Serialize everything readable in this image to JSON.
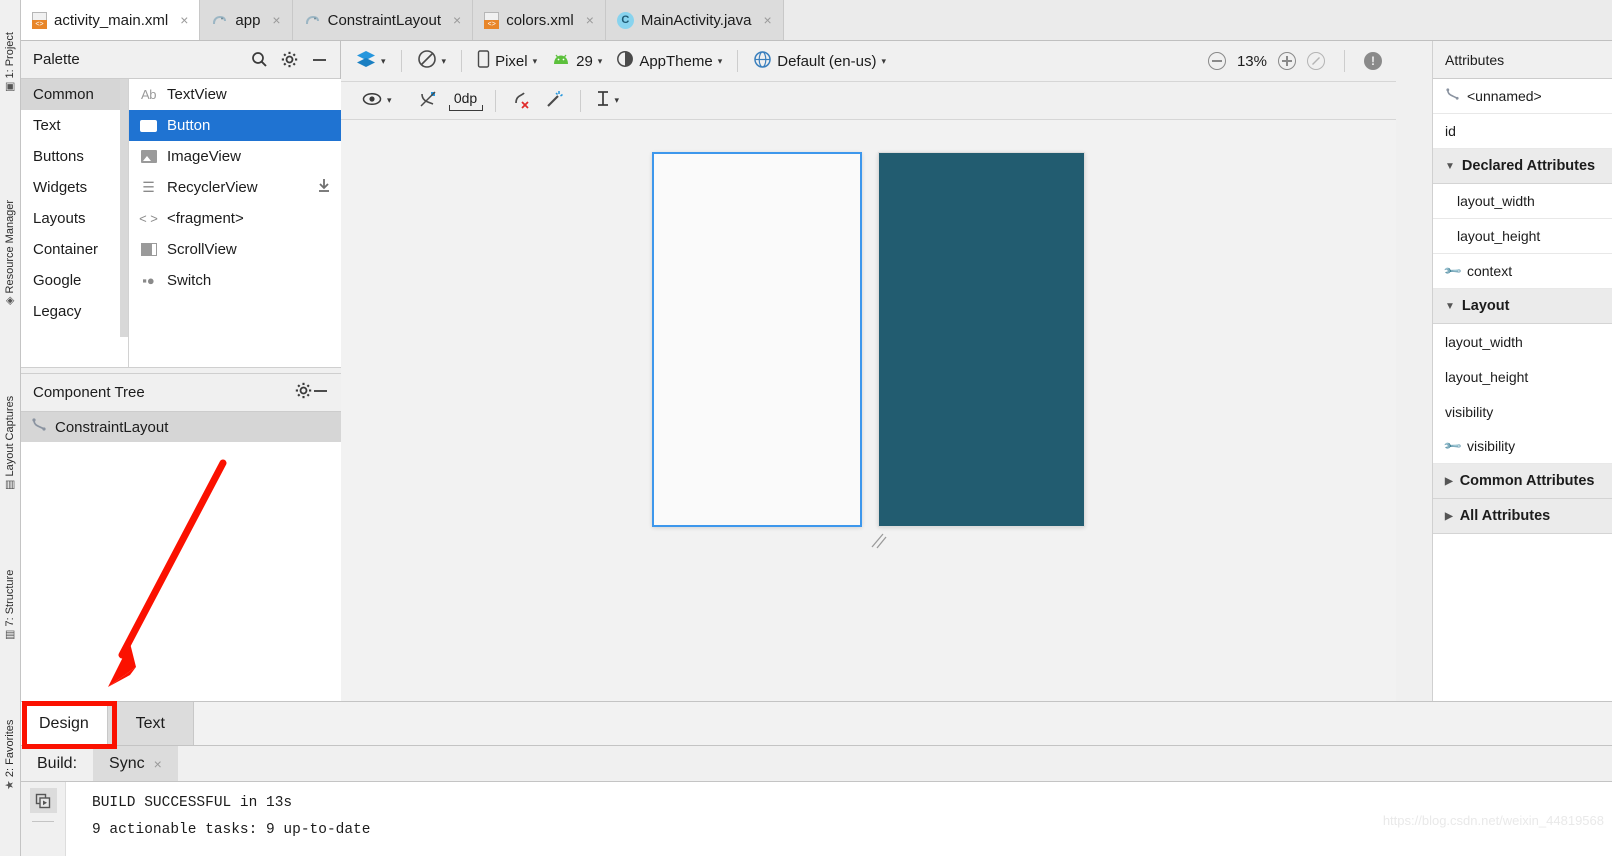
{
  "left_tool_strip": {
    "items": [
      {
        "label": "1: Project",
        "icon": "project-icon"
      },
      {
        "label": "Resource Manager",
        "icon": "resource-manager-icon"
      },
      {
        "label": "Layout Captures",
        "icon": "layout-captures-icon"
      },
      {
        "label": "7: Structure",
        "icon": "structure-icon"
      },
      {
        "label": "2: Favorites",
        "icon": "favorites-icon"
      }
    ]
  },
  "editor_tabs": [
    {
      "label": "activity_main.xml",
      "icon": "xml-layout-icon",
      "active": true,
      "close": "×"
    },
    {
      "label": "app",
      "icon": "gradle-elephant-icon",
      "active": false,
      "close": "×"
    },
    {
      "label": "ConstraintLayout",
      "icon": "gradle-elephant-icon",
      "active": false,
      "close": "×"
    },
    {
      "label": "colors.xml",
      "icon": "xml-values-icon",
      "active": false,
      "close": "×"
    },
    {
      "label": "MainActivity.java",
      "icon": "java-class-icon",
      "active": false,
      "close": "×"
    }
  ],
  "palette": {
    "title": "Palette",
    "icons": {
      "search": "search-icon",
      "settings": "gear-icon",
      "minimize": "minimize-icon"
    },
    "categories": [
      {
        "label": "Common",
        "selected": true
      },
      {
        "label": "Text",
        "selected": false
      },
      {
        "label": "Buttons",
        "selected": false
      },
      {
        "label": "Widgets",
        "selected": false
      },
      {
        "label": "Layouts",
        "selected": false
      },
      {
        "label": "Container",
        "selected": false
      },
      {
        "label": "Google",
        "selected": false
      },
      {
        "label": "Legacy",
        "selected": false
      }
    ],
    "items": [
      {
        "label": "TextView",
        "icon": "textview-icon",
        "selected": false,
        "download": false
      },
      {
        "label": "Button",
        "icon": "button-icon",
        "selected": true,
        "download": false
      },
      {
        "label": "ImageView",
        "icon": "imageview-icon",
        "selected": false,
        "download": false
      },
      {
        "label": "RecyclerView",
        "icon": "recyclerview-icon",
        "selected": false,
        "download": true
      },
      {
        "label": "<fragment>",
        "icon": "fragment-icon",
        "selected": false,
        "download": false
      },
      {
        "label": "ScrollView",
        "icon": "scrollview-icon",
        "selected": false,
        "download": false
      },
      {
        "label": "Switch",
        "icon": "switch-icon",
        "selected": false,
        "download": false
      }
    ]
  },
  "component_tree": {
    "title": "Component Tree",
    "icons": {
      "settings": "gear-icon",
      "minimize": "minimize-icon"
    },
    "nodes": [
      {
        "label": "ConstraintLayout",
        "icon": "constraintlayout-icon",
        "selected": true
      }
    ]
  },
  "design_toolbar": {
    "row1": {
      "design_mode": {
        "label": "",
        "icon": "layers-icon",
        "caret": "▾"
      },
      "orientation": {
        "label": "",
        "icon": "rotate-icon",
        "caret": "▾"
      },
      "device": {
        "label": "Pixel",
        "icon": "phone-icon",
        "caret": "▾"
      },
      "api": {
        "label": "29",
        "icon": "android-icon",
        "caret": "▾"
      },
      "theme": {
        "label": "AppTheme",
        "icon": "theme-icon",
        "caret": "▾"
      },
      "locale": {
        "label": "Default (en-us)",
        "icon": "globe-icon",
        "caret": "▾"
      },
      "zoom_out": "zoom-out-icon",
      "zoom_level": "13%",
      "zoom_in": "zoom-in-icon",
      "zoom_fit": "zoom-fit-icon",
      "issues": "issue-warning-icon"
    },
    "row2": {
      "visibility": {
        "icon": "eye-icon",
        "caret": "▾"
      },
      "autoconnect": {
        "icon": "autoconnect-off-icon"
      },
      "default_margin": {
        "label": "0dp",
        "icon": "margin-icon"
      },
      "clear_constraints": {
        "icon": "clear-constraints-icon"
      },
      "infer_constraints": {
        "icon": "magic-wand-icon"
      },
      "guidelines": {
        "icon": "guideline-icon",
        "caret": "▾"
      }
    }
  },
  "canvas": {
    "blueprint_frame": {
      "name": "blueprint-preview",
      "border_color": "#3d97ec",
      "fill": "#fafafa"
    },
    "render_frame": {
      "name": "rendered-preview",
      "fill": "#225c70"
    },
    "resize_handle": "resize-handle-icon"
  },
  "attributes": {
    "title": "Attributes",
    "selected_component": {
      "label": "<unnamed>",
      "icon": "constraintlayout-icon"
    },
    "rows": [
      {
        "label": "id",
        "kind": "field",
        "indent": false,
        "icon": null
      },
      {
        "label": "Declared Attributes",
        "kind": "section",
        "indent": false,
        "tri": "▼"
      },
      {
        "label": "layout_width",
        "kind": "field",
        "indent": true,
        "icon": null
      },
      {
        "label": "layout_height",
        "kind": "field",
        "indent": true,
        "icon": null
      },
      {
        "label": "context",
        "kind": "field",
        "indent": false,
        "icon": "wrench-icon"
      },
      {
        "label": "Layout",
        "kind": "section",
        "indent": false,
        "tri": "▼"
      },
      {
        "label": "layout_width",
        "kind": "plain",
        "indent": false,
        "icon": null
      },
      {
        "label": "layout_height",
        "kind": "plain",
        "indent": false,
        "icon": null
      },
      {
        "label": "visibility",
        "kind": "plain",
        "indent": false,
        "icon": null
      },
      {
        "label": "visibility",
        "kind": "plain",
        "indent": false,
        "icon": "wrench-icon"
      },
      {
        "label": "Common Attributes",
        "kind": "section",
        "indent": false,
        "tri": "▶"
      },
      {
        "label": "All Attributes",
        "kind": "section",
        "indent": false,
        "tri": "▶"
      }
    ]
  },
  "editor_mode_tabs": [
    {
      "label": "Design",
      "active": true
    },
    {
      "label": "Text",
      "active": false
    }
  ],
  "bottom_tool_tabs": [
    {
      "label": "Build:",
      "active": false,
      "close": ""
    },
    {
      "label": "Sync",
      "active": true,
      "close": "×"
    }
  ],
  "console": {
    "gutter_icons": [
      "restart-icon"
    ],
    "lines": [
      "BUILD SUCCESSFUL in 13s",
      "9 actionable tasks: 9 up-to-date"
    ]
  },
  "annotations": {
    "highlight_box": {
      "target": "Design",
      "color": "#fb1100"
    },
    "arrow": {
      "points_to": "Design",
      "color": "#fb1100"
    }
  },
  "watermark": "https://blog.csdn.net/weixin_44819568",
  "colors": {
    "accent_blue": "#1f73d2",
    "selection_border": "#3d97ec",
    "render_teal": "#225c70",
    "annotation_red": "#fb1100",
    "panel_bg": "#f0f0f0"
  }
}
